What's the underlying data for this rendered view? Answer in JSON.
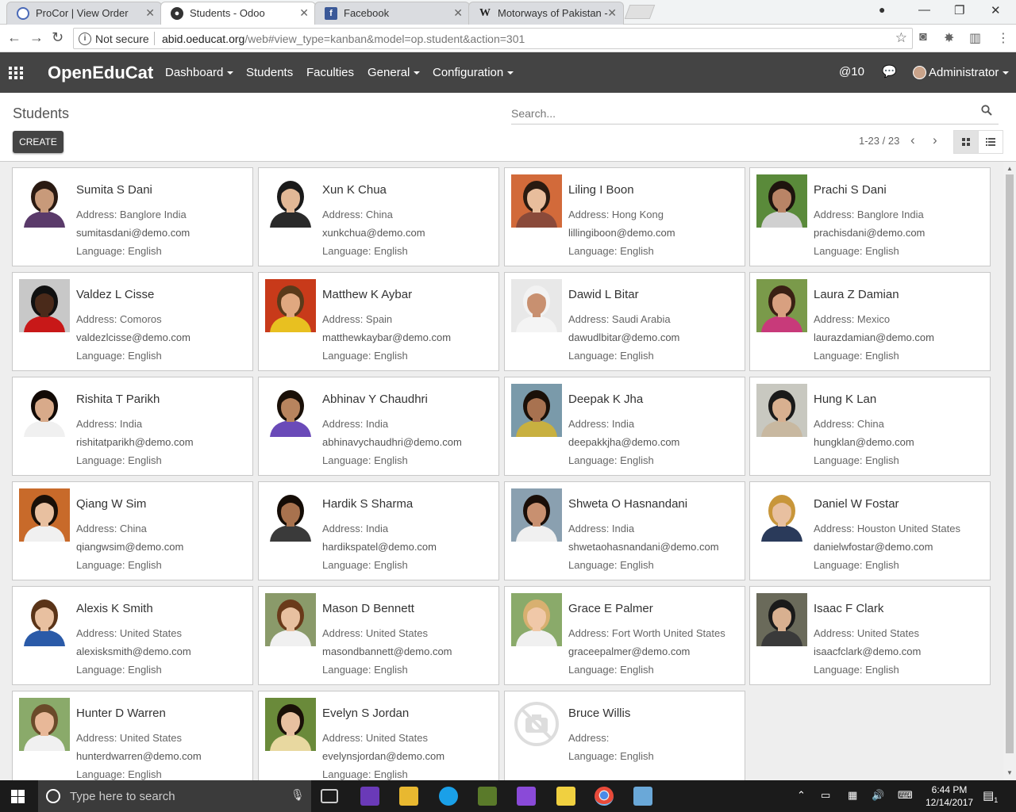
{
  "browser": {
    "tabs": [
      {
        "title": "ProCor | View Order",
        "favicon": "procor-icon",
        "active": false
      },
      {
        "title": "Students - Odoo",
        "favicon": "odoo-icon",
        "active": true
      },
      {
        "title": "Facebook",
        "favicon": "facebook-icon",
        "active": false
      },
      {
        "title": "Motorways of Pakistan -",
        "favicon": "wikipedia-icon",
        "active": false
      }
    ],
    "security_label": "Not secure",
    "url_host": "abid.oeducat.org",
    "url_path": "/web#view_type=kanban&model=op.student&action=301"
  },
  "navbar": {
    "brand": "OpenEduCat",
    "menus": [
      {
        "label": "Dashboard",
        "dropdown": true
      },
      {
        "label": "Students",
        "dropdown": false
      },
      {
        "label": "Faculties",
        "dropdown": false
      },
      {
        "label": "General",
        "dropdown": true
      },
      {
        "label": "Configuration",
        "dropdown": true
      }
    ],
    "messages_count": "10",
    "user": "Administrator"
  },
  "control_panel": {
    "title": "Students",
    "search_placeholder": "Search...",
    "create_label": "CREATE",
    "pager": "1-23 / 23"
  },
  "students": [
    {
      "name": "Sumita S Dani",
      "address": "Address: Banglore India",
      "email": "sumitasdani@demo.com",
      "language": "Language: English",
      "skin": "#c89a7a",
      "hair": "#2a1a12",
      "bg": "#ffffff",
      "shirt": "#5a3a6a"
    },
    {
      "name": "Xun K Chua",
      "address": "Address: China",
      "email": "xunkchua@demo.com",
      "language": "Language: English",
      "skin": "#e2b896",
      "hair": "#1a1a1a",
      "bg": "#ffffff",
      "shirt": "#2a2a2a"
    },
    {
      "name": "Liling I Boon",
      "address": "Address: Hong Kong",
      "email": "lillingiboon@demo.com",
      "language": "Language: English",
      "skin": "#e8bd9c",
      "hair": "#2a1a10",
      "bg": "#d26a3a",
      "shirt": "#8a4a3a"
    },
    {
      "name": "Prachi S Dani",
      "address": "Address: Banglore India",
      "email": "prachisdani@demo.com",
      "language": "Language: English",
      "skin": "#b98466",
      "hair": "#1e140e",
      "bg": "#5a8a3a",
      "shirt": "#d0d0d0"
    },
    {
      "name": "Valdez L Cisse",
      "address": "Address: Comoros",
      "email": "valdezlcisse@demo.com",
      "language": "Language: English",
      "skin": "#4a2a1a",
      "hair": "#111111",
      "bg": "#c8c8c8",
      "shirt": "#c81818"
    },
    {
      "name": "Matthew K Aybar",
      "address": "Address: Spain",
      "email": "matthewkaybar@demo.com",
      "language": "Language: English",
      "skin": "#e0a880",
      "hair": "#5a3a1a",
      "bg": "#c83a1a",
      "shirt": "#e8c020"
    },
    {
      "name": "Dawid L Bitar",
      "address": "Address: Saudi Arabia",
      "email": "dawudlbitar@demo.com",
      "language": "Language: English",
      "skin": "#c89070",
      "hair": "#f2f2f2",
      "bg": "#e8e8e8",
      "shirt": "#f4f4f4"
    },
    {
      "name": "Laura Z Damian",
      "address": "Address: Mexico",
      "email": "laurazdamian@demo.com",
      "language": "Language: English",
      "skin": "#d8a080",
      "hair": "#3a2014",
      "bg": "#7a9a4a",
      "shirt": "#c83a7a"
    },
    {
      "name": "Rishita T Parikh",
      "address": "Address: India",
      "email": "rishitatparikh@demo.com",
      "language": "Language: English",
      "skin": "#d8aa8a",
      "hair": "#120a06",
      "bg": "#ffffff",
      "shirt": "#f0f0f0"
    },
    {
      "name": "Abhinav Y Chaudhri",
      "address": "Address: India",
      "email": "abhinavychaudhri@demo.com",
      "language": "Language: English",
      "skin": "#b8845e",
      "hair": "#1a1008",
      "bg": "#ffffff",
      "shirt": "#6a4ab8"
    },
    {
      "name": "Deepak K Jha",
      "address": "Address: India",
      "email": "deepakkjha@demo.com",
      "language": "Language: English",
      "skin": "#a87250",
      "hair": "#1a1008",
      "bg": "#7a9aaa",
      "shirt": "#c8b040"
    },
    {
      "name": "Hung K Lan",
      "address": "Address: China",
      "email": "hungklan@demo.com",
      "language": "Language: English",
      "skin": "#d8b090",
      "hair": "#1a1a1a",
      "bg": "#c8c8c0",
      "shirt": "#c8b8a0"
    },
    {
      "name": "Qiang W Sim",
      "address": "Address: China",
      "email": "qiangwsim@demo.com",
      "language": "Language: English",
      "skin": "#e8c0a0",
      "hair": "#1a1008",
      "bg": "#c86a2a",
      "shirt": "#f0f0f0"
    },
    {
      "name": "Hardik S Sharma",
      "address": "Address: India",
      "email": "hardikspatel@demo.com",
      "language": "Language: English",
      "skin": "#a8724e",
      "hair": "#140c06",
      "bg": "#ffffff",
      "shirt": "#3a3a3a"
    },
    {
      "name": "Shweta O Hasnandani",
      "address": "Address: India",
      "email": "shwetaohasnandani@demo.com",
      "language": "Language: English",
      "skin": "#c89070",
      "hair": "#1a0e08",
      "bg": "#8aa0b0",
      "shirt": "#f0f0f0"
    },
    {
      "name": "Daniel W Fostar",
      "address": "Address: Houston United States",
      "email": "danielwfostar@demo.com",
      "language": "Language: English",
      "skin": "#e8c0a0",
      "hair": "#c8963a",
      "bg": "#ffffff",
      "shirt": "#2a3a5a"
    },
    {
      "name": "Alexis K Smith",
      "address": "Address: United States",
      "email": "alexisksmith@demo.com",
      "language": "Language: English",
      "skin": "#e8c0a0",
      "hair": "#5a3418",
      "bg": "#ffffff",
      "shirt": "#2a5aa8"
    },
    {
      "name": "Mason D Bennett",
      "address": "Address: United States",
      "email": "masondbannett@demo.com",
      "language": "Language: English",
      "skin": "#e8c0a0",
      "hair": "#6a3a1a",
      "bg": "#8a9a6a",
      "shirt": "#f0f0f0"
    },
    {
      "name": "Grace E Palmer",
      "address": "Address: Fort Worth United States",
      "email": "graceepalmer@demo.com",
      "language": "Language: English",
      "skin": "#f0c8a8",
      "hair": "#d8b070",
      "bg": "#8aaa6a",
      "shirt": "#f0f0f0"
    },
    {
      "name": "Isaac F Clark",
      "address": "Address: United States",
      "email": "isaacfclark@demo.com",
      "language": "Language: English",
      "skin": "#d8b090",
      "hair": "#1a1a1a",
      "bg": "#6a6a5a",
      "shirt": "#3a3a3a"
    },
    {
      "name": "Hunter D Warren",
      "address": "Address: United States",
      "email": "hunterdwarren@demo.com",
      "language": "Language: English",
      "skin": "#e8b898",
      "hair": "#6a4a2a",
      "bg": "#8aaa6a",
      "shirt": "#f0f0f0"
    },
    {
      "name": "Evelyn S Jordan",
      "address": "Address: United States",
      "email": "evelynsjordan@demo.com",
      "language": "Language: English",
      "skin": "#e8c0a0",
      "hair": "#1a1008",
      "bg": "#6a8a3a",
      "shirt": "#e8d8a0"
    },
    {
      "name": "Bruce Willis",
      "address": "Address:",
      "email": "",
      "language": "Language: English",
      "placeholder_photo": true
    }
  ],
  "taskbar": {
    "search_placeholder": "Type here to search",
    "time": "6:44 PM",
    "date": "12/14/2017",
    "notification_count": "1"
  }
}
